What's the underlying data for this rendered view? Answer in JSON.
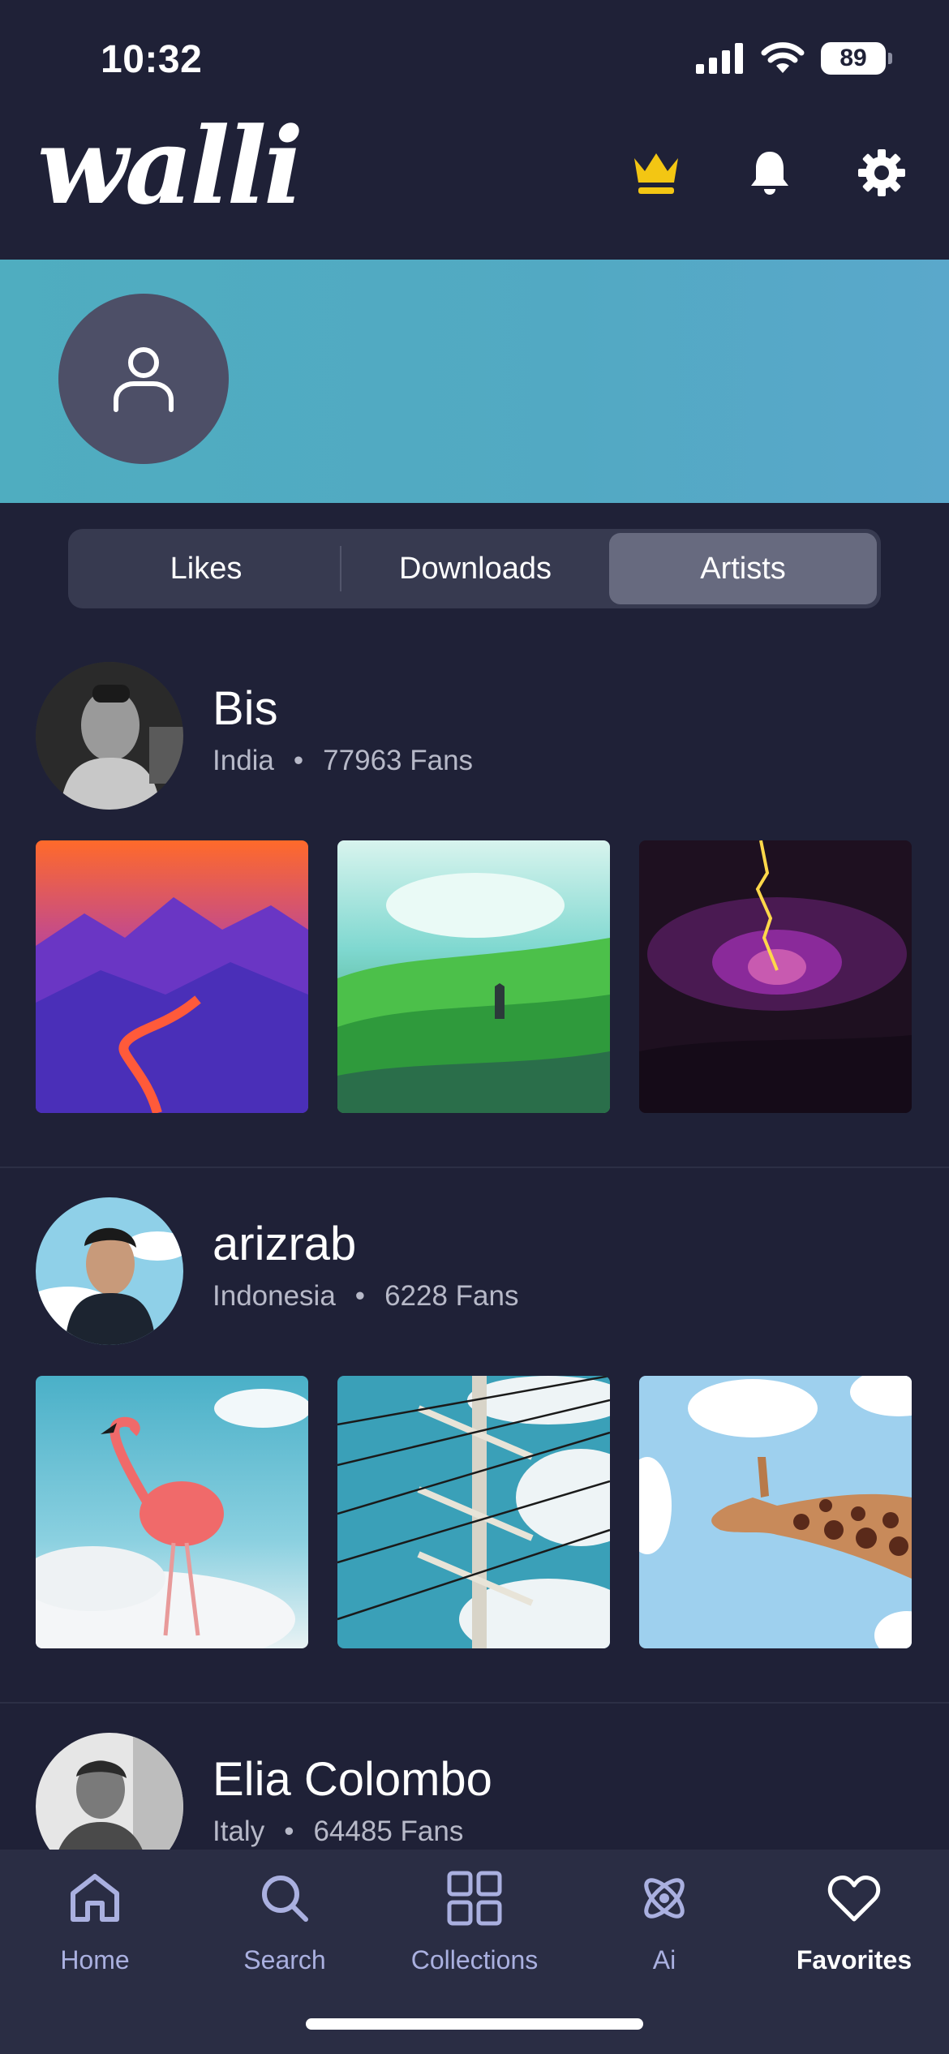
{
  "status": {
    "time": "10:32",
    "battery": "89"
  },
  "header": {
    "logo": "walli",
    "icons": [
      "crown-icon",
      "bell-icon",
      "gear-icon"
    ],
    "crown_color": "#f3c613"
  },
  "profile": {
    "avatar_icon": "user-icon"
  },
  "segments": [
    {
      "label": "Likes",
      "active": false
    },
    {
      "label": "Downloads",
      "active": false
    },
    {
      "label": "Artists",
      "active": true
    }
  ],
  "artists": [
    {
      "name": "Bis",
      "country": "India",
      "separator": "•",
      "fans": "77963 Fans"
    },
    {
      "name": "arizrab",
      "country": "Indonesia",
      "separator": "•",
      "fans": "6228 Fans"
    },
    {
      "name": "Elia Colombo",
      "country": "Italy",
      "separator": "•",
      "fans": "64485 Fans"
    }
  ],
  "tabbar": [
    {
      "label": "Home",
      "icon": "home-icon"
    },
    {
      "label": "Search",
      "icon": "search-icon"
    },
    {
      "label": "Collections",
      "icon": "grid-icon"
    },
    {
      "label": "Ai",
      "icon": "atom-icon"
    },
    {
      "label": "Favorites",
      "icon": "heart-icon",
      "active": true
    }
  ]
}
